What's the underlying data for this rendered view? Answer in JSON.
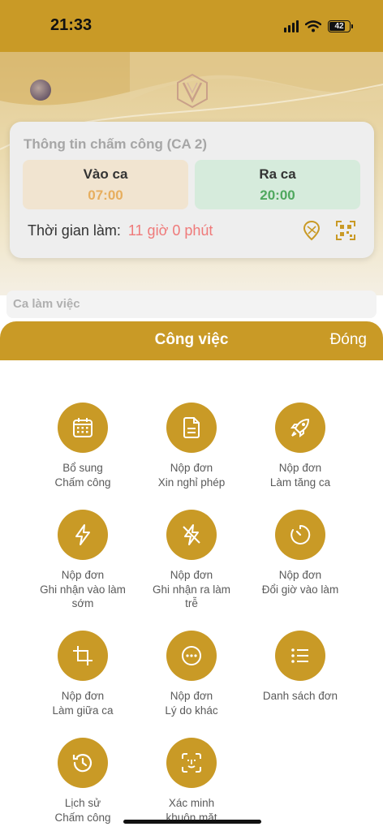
{
  "status_bar": {
    "time": "21:33",
    "battery": "42"
  },
  "attendance_card": {
    "title": "Thông tin chấm công (CA 2)",
    "check_in": {
      "label": "Vào ca",
      "time": "07:00"
    },
    "check_out": {
      "label": "Ra ca",
      "time": "20:00"
    },
    "work_time_label": "Thời gian làm:",
    "work_time_value": "11 giờ 0 phút"
  },
  "section_label": "Ca làm việc",
  "sheet": {
    "title": "Công việc",
    "close_label": "Đóng",
    "items": [
      {
        "icon": "calendar-icon",
        "lines": [
          "Bổ sung",
          "Chấm công"
        ]
      },
      {
        "icon": "document-icon",
        "lines": [
          "Nộp đơn",
          "Xin nghỉ phép"
        ]
      },
      {
        "icon": "rocket-icon",
        "lines": [
          "Nộp đơn",
          "Làm tăng ca"
        ]
      },
      {
        "icon": "lightning-icon",
        "lines": [
          "Nộp đơn",
          "Ghi nhận vào làm",
          "sớm"
        ]
      },
      {
        "icon": "lightning-off-icon",
        "lines": [
          "Nộp đơn",
          "Ghi nhận ra làm",
          "trễ"
        ]
      },
      {
        "icon": "timer-icon",
        "lines": [
          "Nộp đơn",
          "Đổi giờ vào làm"
        ]
      },
      {
        "icon": "crop-icon",
        "lines": [
          "Nộp đơn",
          "Làm giữa ca"
        ]
      },
      {
        "icon": "more-icon",
        "lines": [
          "Nộp đơn",
          "Lý do khác"
        ]
      },
      {
        "icon": "list-icon",
        "lines": [
          "Danh sách đơn"
        ]
      },
      {
        "icon": "history-icon",
        "lines": [
          "Lịch sử",
          "Chấm công"
        ]
      },
      {
        "icon": "face-id-icon",
        "lines": [
          "Xác minh",
          "khuôn mặt"
        ]
      }
    ]
  },
  "colors": {
    "accent": "#c99a26",
    "check_in_bg": "#f1e4d0",
    "check_out_bg": "#d6ebdc",
    "work_time": "#ef7a7a"
  }
}
